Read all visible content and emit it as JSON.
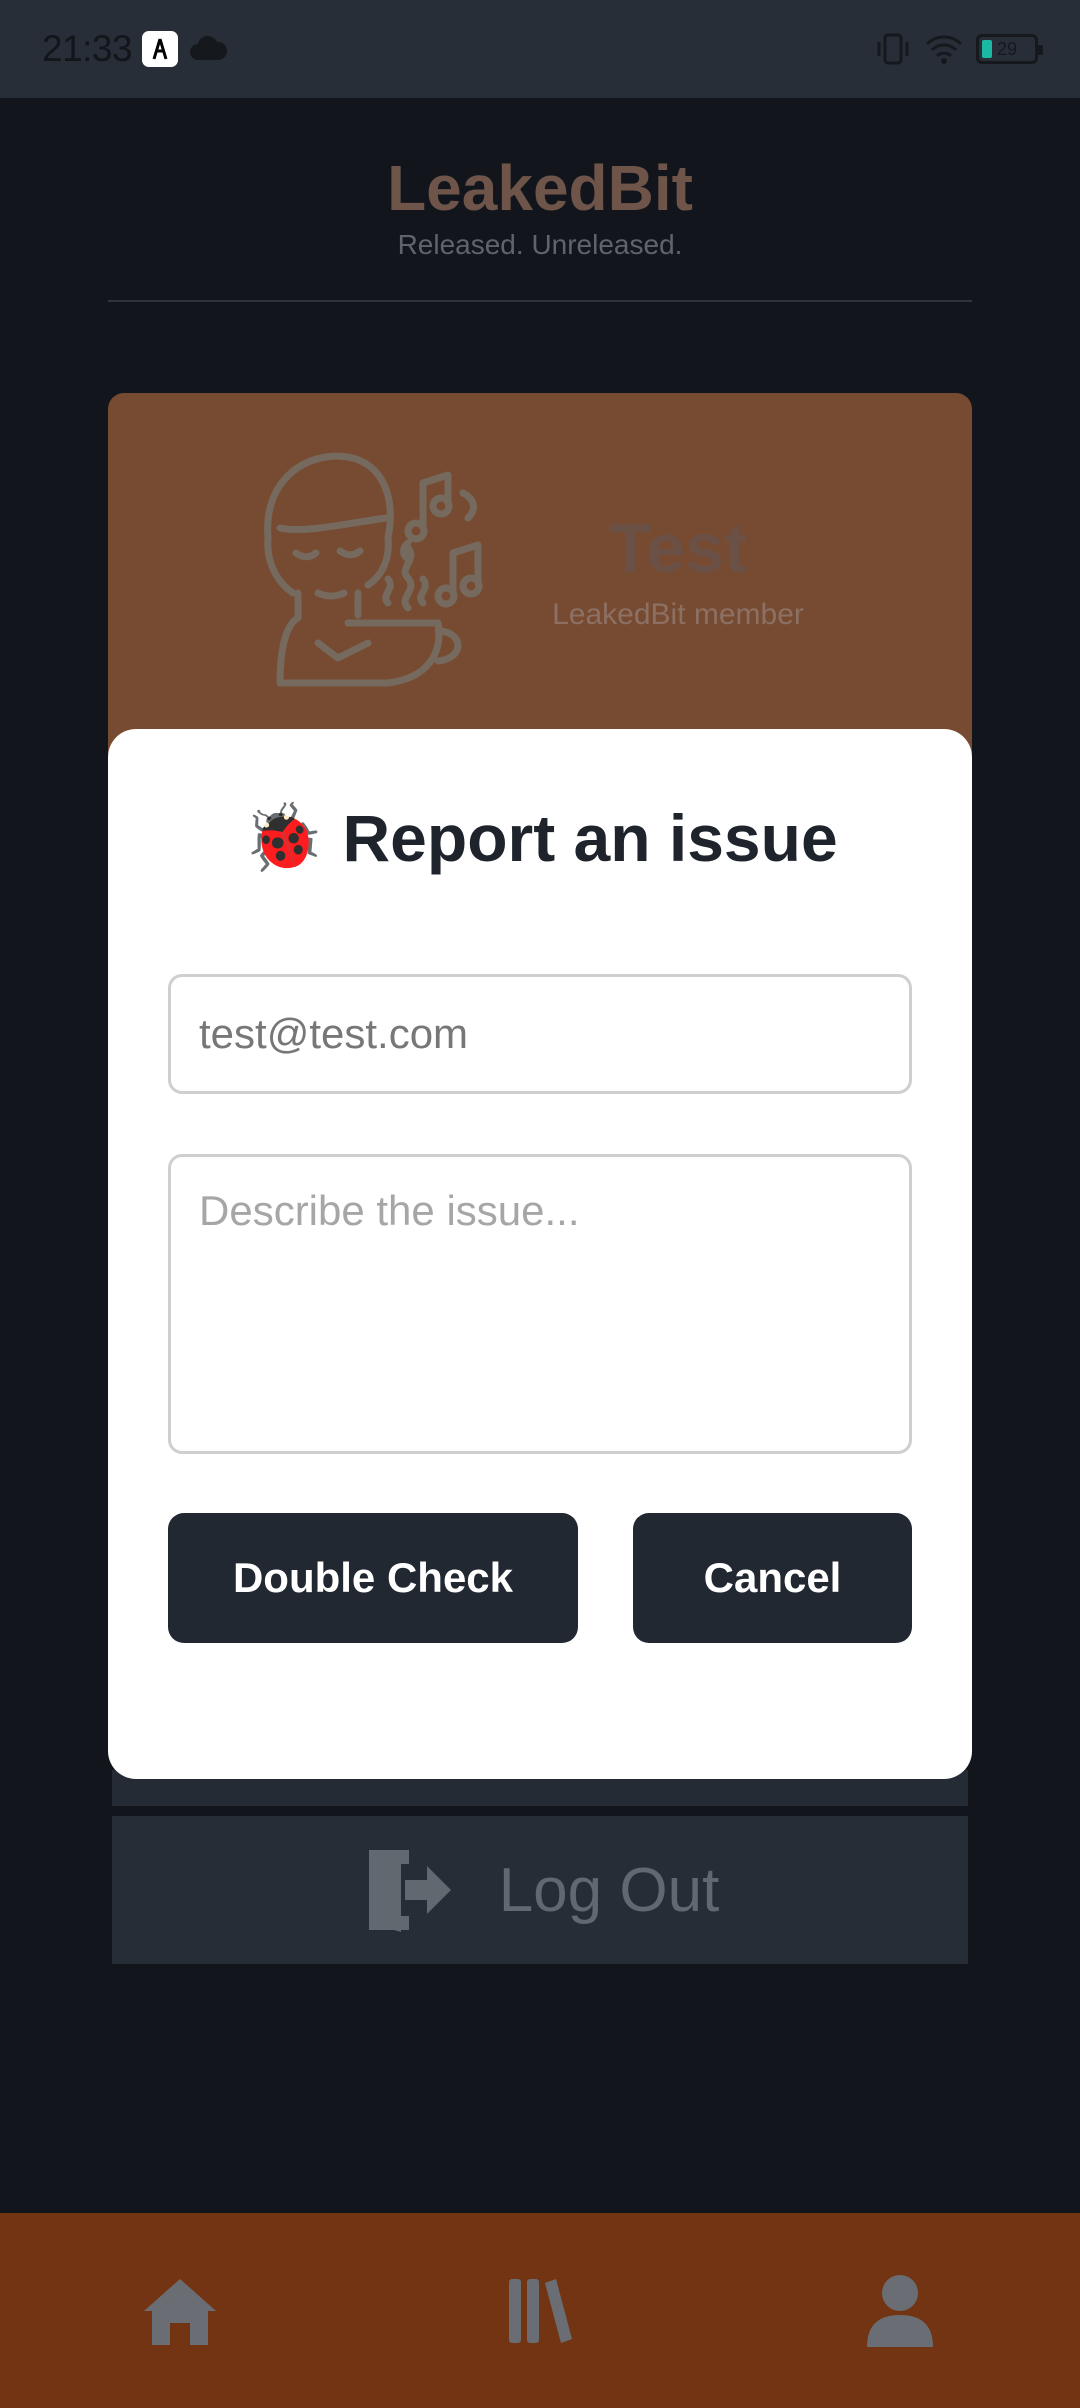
{
  "status_bar": {
    "time": "21:33",
    "notification_icons": [
      "app-notification-icon",
      "cloud-icon"
    ],
    "system_icons": [
      "vibrate-icon",
      "wifi-icon",
      "battery-icon"
    ],
    "battery_level": "29"
  },
  "header": {
    "title": "LeakedBit",
    "subtitle": "Released. Unreleased."
  },
  "profile": {
    "name": "Test",
    "role": "LeakedBit member"
  },
  "logout": {
    "label": "Log Out",
    "icon": "logout-icon"
  },
  "modal": {
    "title_icon": "🐞",
    "title": "Report an issue",
    "email_value": "test@test.com",
    "description_placeholder": "Describe the issue...",
    "primary_button": "Double Check",
    "secondary_button": "Cancel"
  },
  "bottom_nav": {
    "items": [
      {
        "name": "home",
        "icon": "home-icon"
      },
      {
        "name": "library",
        "icon": "library-icon"
      },
      {
        "name": "profile",
        "icon": "user-icon"
      }
    ]
  },
  "colors": {
    "background": "#12161c",
    "status_bar": "#272e38",
    "profile_card": "#774b31",
    "bottom_nav": "#733413",
    "button": "#222831",
    "modal": "#ffffff"
  }
}
